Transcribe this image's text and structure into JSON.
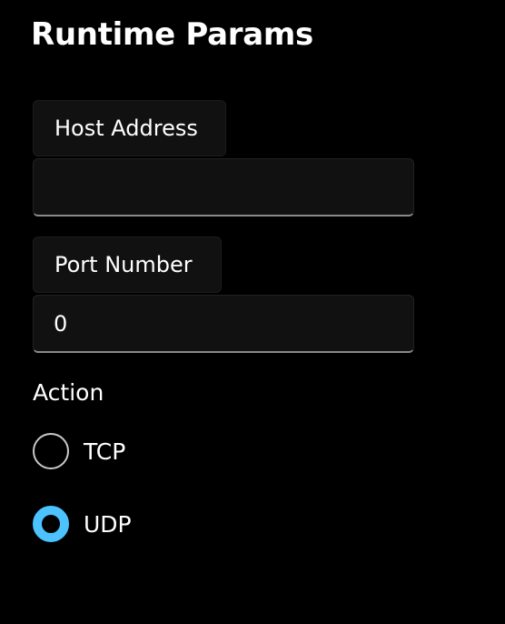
{
  "page": {
    "title": "Runtime Params"
  },
  "form": {
    "host": {
      "label": "Host Address",
      "value": ""
    },
    "port": {
      "label": "Port Number",
      "value": "0"
    },
    "action": {
      "label": "Action",
      "options": [
        {
          "label": "TCP",
          "checked": false
        },
        {
          "label": "UDP",
          "checked": true
        }
      ]
    }
  },
  "colors": {
    "background": "#000000",
    "field_background": "#111111",
    "accent": "#4cc2ff",
    "text": "#ffffff"
  }
}
